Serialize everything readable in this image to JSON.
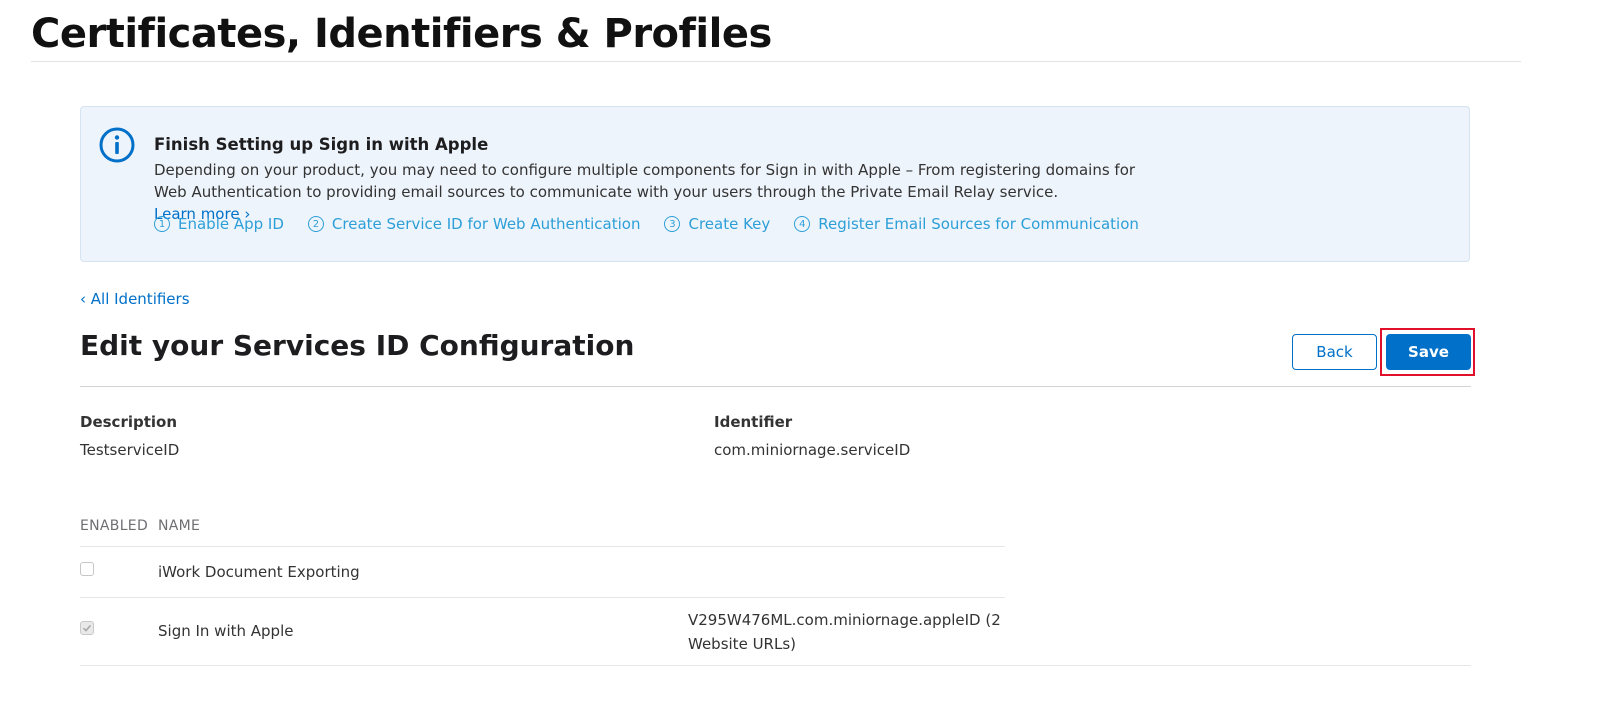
{
  "header": {
    "title": "Certificates, Identifiers & Profiles"
  },
  "banner": {
    "icon": "info-icon",
    "title": "Finish Setting up Sign in with Apple",
    "text": "Depending on your product, you may need to configure multiple components for Sign in with Apple – From registering domains for Web Authentication to providing email sources to communicate with your users through the Private Email Relay service.",
    "learn_more": "Learn more ›",
    "steps": [
      {
        "num": "1",
        "label": "Enable App ID"
      },
      {
        "num": "2",
        "label": "Create Service ID for Web Authentication"
      },
      {
        "num": "3",
        "label": "Create Key"
      },
      {
        "num": "4",
        "label": "Register Email Sources for Communication"
      }
    ],
    "accent_color": "#2d9fd8"
  },
  "nav": {
    "back_link": "‹ All Identifiers"
  },
  "section": {
    "title": "Edit your Services ID Configuration",
    "back_label": "Back",
    "save_label": "Save"
  },
  "fields": {
    "description": {
      "label": "Description",
      "value": "TestserviceID"
    },
    "identifier": {
      "label": "Identifier",
      "value": "com.miniornage.serviceID"
    }
  },
  "table": {
    "headers": {
      "enabled": "ENABLED",
      "name": "NAME"
    },
    "rows": [
      {
        "enabled": false,
        "name": "iWork Document Exporting",
        "config": ""
      },
      {
        "enabled": true,
        "name": "Sign In with Apple",
        "config": "V295W476ML.com.miniornage.appleID (2 Website URLs)"
      }
    ]
  },
  "colors": {
    "primary": "#0070c9",
    "highlight": "#e0102a"
  }
}
